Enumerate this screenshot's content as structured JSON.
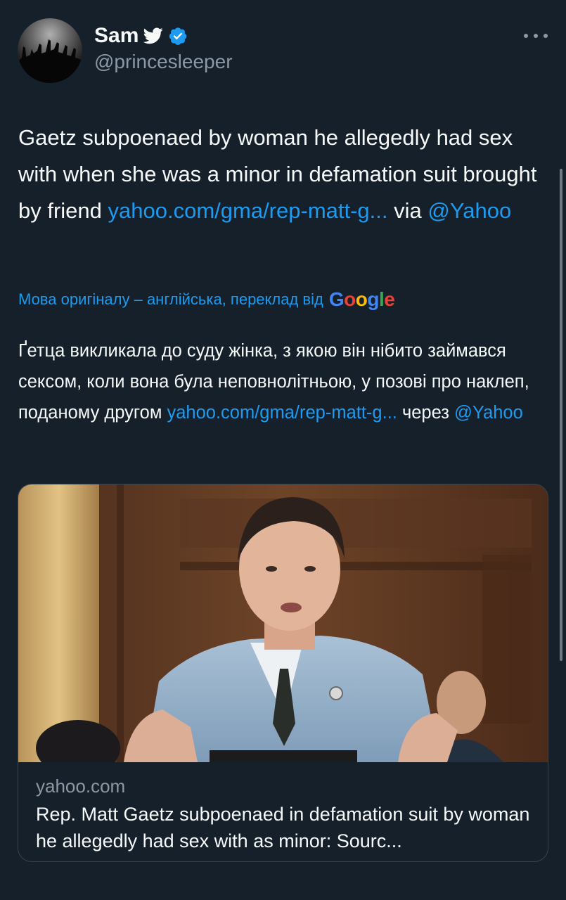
{
  "author": {
    "name": "Sam",
    "handle": "@princesleeper",
    "badge_icon": "bird-icon",
    "verified_icon": "verified-badge-icon"
  },
  "tweet": {
    "text": "Gaetz subpoenaed by woman he allegedly had sex with when she was a minor in defamation suit brought by friend ",
    "link_text": "yahoo.com/gma/rep-matt-g...",
    "via": " via ",
    "mention": "@Yahoo"
  },
  "translation": {
    "label": "Мова оригіналу – англійська, переклад від",
    "provider": "Google",
    "text": "Ґетца викликала до суду жінка, з якою він нібито займався сексом, коли вона була неповнолітньою, у позові про наклеп, поданому другом ",
    "link_text": "yahoo.com/gma/rep-matt-g...",
    "via": " через ",
    "mention": "@Yahoo"
  },
  "card": {
    "domain": "yahoo.com",
    "title": "Rep. Matt Gaetz subpoenaed in defamation suit by woman he allegedly had sex with as minor: Sourc..."
  },
  "colors": {
    "background": "#15202b",
    "link": "#1d9bf0",
    "secondary_text": "#8b98a5",
    "verified": "#1d9bf0"
  }
}
